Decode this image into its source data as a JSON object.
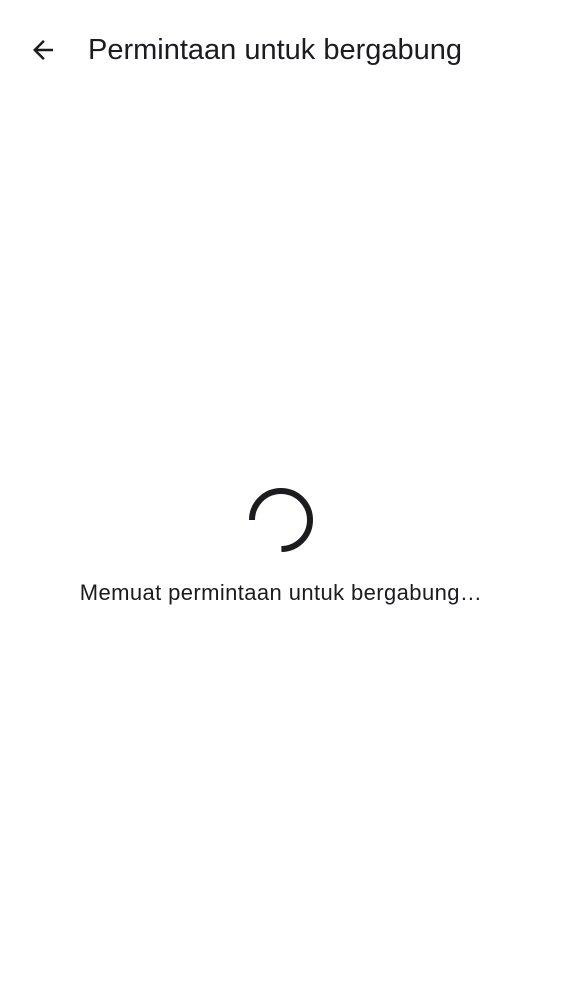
{
  "header": {
    "title": "Permintaan untuk bergabung",
    "back_icon": "arrow-back-icon"
  },
  "content": {
    "loading_text": "Memuat permintaan untuk bergabung…",
    "spinner_icon": "progress-spinner-icon"
  },
  "colors": {
    "foreground": "#1c1b1f",
    "background": "#ffffff"
  }
}
